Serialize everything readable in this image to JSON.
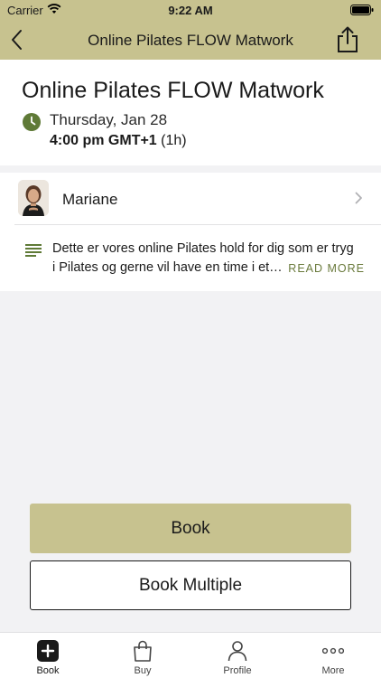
{
  "status_bar": {
    "carrier": "Carrier",
    "time": "9:22 AM"
  },
  "nav": {
    "title": "Online Pilates FLOW Matwork",
    "back_icon": "chevron-left-icon",
    "share_icon": "share-icon"
  },
  "class": {
    "title": "Online Pilates FLOW Matwork",
    "date": "Thursday, Jan 28",
    "time": "4:00 pm GMT+1",
    "duration": "(1h)"
  },
  "instructor": {
    "name": "Mariane"
  },
  "description": {
    "line1": "Dette er vores online Pilates hold for dig som er tryg",
    "line2": "i Pilates og gerne vil have en time i et…",
    "read_more": "READ MORE"
  },
  "actions": {
    "book": "Book",
    "book_multiple": "Book Multiple"
  },
  "tabs": [
    {
      "label": "Book",
      "icon": "plus-square-icon",
      "active": true
    },
    {
      "label": "Buy",
      "icon": "bag-icon",
      "active": false
    },
    {
      "label": "Profile",
      "icon": "person-icon",
      "active": false
    },
    {
      "label": "More",
      "icon": "ellipsis-icon",
      "active": false
    }
  ],
  "colors": {
    "accent": "#c7c28f",
    "icon_green": "#5f7a37",
    "link": "#6a7a3c"
  }
}
